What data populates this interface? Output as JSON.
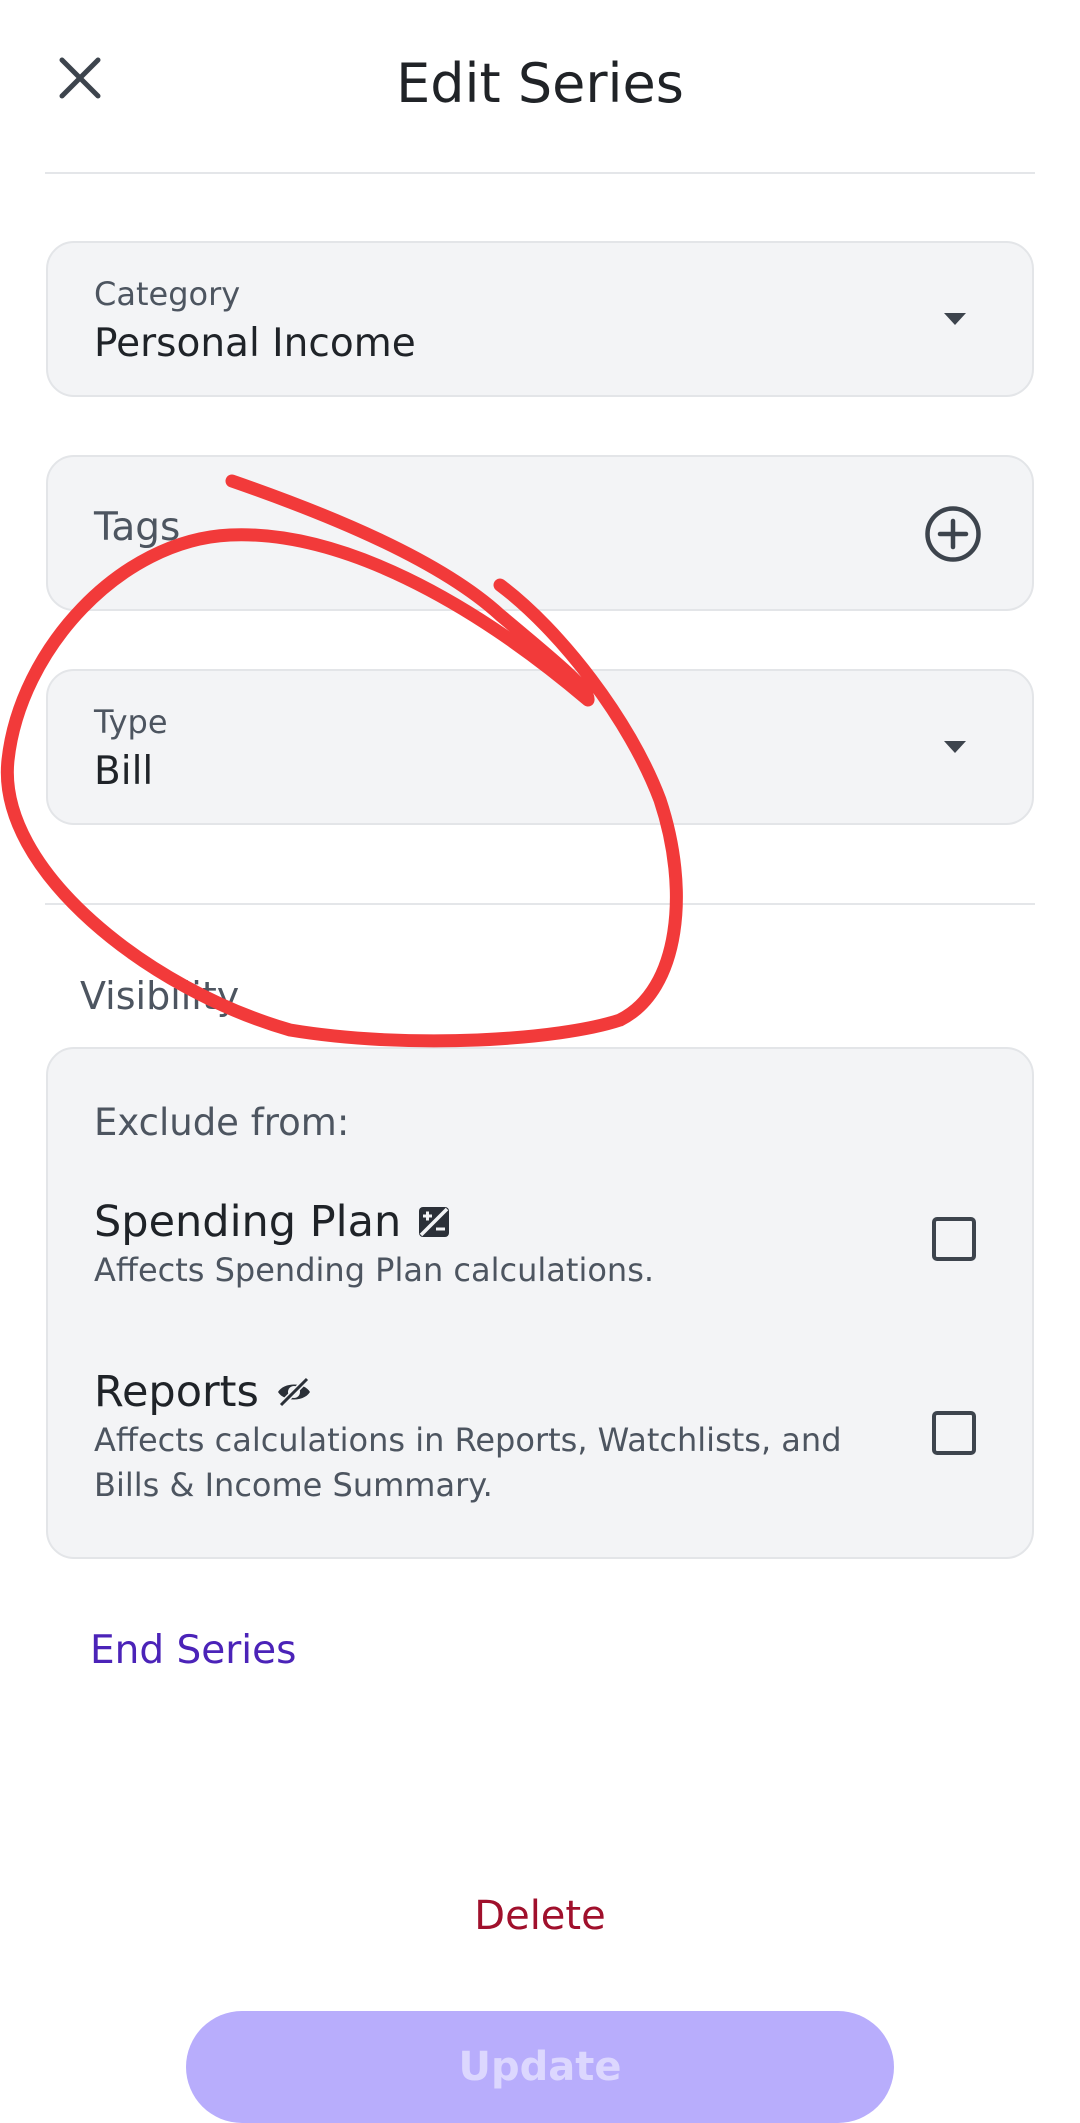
{
  "header": {
    "title": "Edit Series",
    "close_icon": "close-icon"
  },
  "fields": {
    "category": {
      "label": "Category",
      "value": "Personal Income",
      "icon": "caret-down-icon"
    },
    "tags": {
      "label": "Tags",
      "icon": "plus-circle-icon"
    },
    "type": {
      "label": "Type",
      "value": "Bill",
      "icon": "caret-down-icon"
    }
  },
  "visibility": {
    "title": "Visibility",
    "exclude_label": "Exclude from:",
    "options": [
      {
        "title": "Spending Plan",
        "icon": "spending-plan-icon",
        "description": "Affects Spending Plan calculations.",
        "checked": false
      },
      {
        "title": "Reports",
        "icon": "eye-off-icon",
        "description": "Affects calculations in Reports, Watchlists, and Bills & Income Summary.",
        "checked": false
      }
    ]
  },
  "actions": {
    "end_series": "End Series",
    "delete": "Delete",
    "update": "Update"
  },
  "colors": {
    "link_purple": "#4b23b8",
    "delete_red": "#a0102c",
    "update_disabled": "#b8adfc",
    "annotation_red": "#f23a3a"
  }
}
